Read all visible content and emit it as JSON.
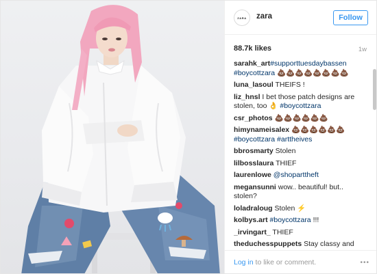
{
  "account": {
    "avatar_text": "ZARA",
    "username": "zara",
    "follow_label": "Follow"
  },
  "post": {
    "likes": "88.7k likes",
    "time_ago": "1w"
  },
  "comments": [
    {
      "user": "sarahk_art",
      "parts": [
        {
          "t": "#supporttuesdaybassen #boycottzara",
          "tag": true
        },
        {
          "t": " 💩💩💩💩💩💩💩💩",
          "tag": false
        }
      ]
    },
    {
      "user": "luna_lasoul",
      "parts": [
        {
          "t": " THEIFS !",
          "tag": false
        }
      ]
    },
    {
      "user": "liz_hnsl",
      "parts": [
        {
          "t": " I bet those patch designs are stolen, too 👌 ",
          "tag": false
        },
        {
          "t": "#boycottzara",
          "tag": true
        }
      ]
    },
    {
      "user": "csr_photos",
      "parts": [
        {
          "t": " 💩💩💩💩💩💩",
          "tag": false
        }
      ]
    },
    {
      "user": "himynameisalex",
      "parts": [
        {
          "t": " 💩💩💩💩💩💩 ",
          "tag": false
        },
        {
          "t": "#boycottzara #arttheives",
          "tag": true
        }
      ]
    },
    {
      "user": "bbrosmarty",
      "parts": [
        {
          "t": " Stolen",
          "tag": false
        }
      ]
    },
    {
      "user": "lilbosslaura",
      "parts": [
        {
          "t": " THIEF",
          "tag": false
        }
      ]
    },
    {
      "user": "laurenlowe",
      "parts": [
        {
          "t": " ",
          "tag": false
        },
        {
          "t": "@shoparttheft",
          "tag": true
        }
      ]
    },
    {
      "user": "megansunni",
      "parts": [
        {
          "t": " wow.. beautiful! but.. stolen?",
          "tag": false
        }
      ]
    },
    {
      "user": "loladraloug",
      "parts": [
        {
          "t": " Stolen ⚡",
          "tag": false
        }
      ]
    },
    {
      "user": "kolbys.art",
      "parts": [
        {
          "t": " ",
          "tag": false
        },
        {
          "t": "#boycottzara",
          "tag": true
        },
        {
          "t": " !!!",
          "tag": false
        }
      ]
    },
    {
      "user": "_irvingart_",
      "parts": [
        {
          "t": " THIEF",
          "tag": false
        }
      ]
    },
    {
      "user": "theduchesspuppets",
      "parts": [
        {
          "t": " Stay classy and",
          "tag": false
        }
      ]
    }
  ],
  "footer": {
    "login_link": "Log in",
    "login_rest": " to like or comment.",
    "more_icon": "more-options-icon",
    "more_glyph": "•••"
  },
  "colors": {
    "accent": "#3897f0",
    "hashtag": "#003569",
    "muted": "#999999",
    "text": "#262626"
  }
}
